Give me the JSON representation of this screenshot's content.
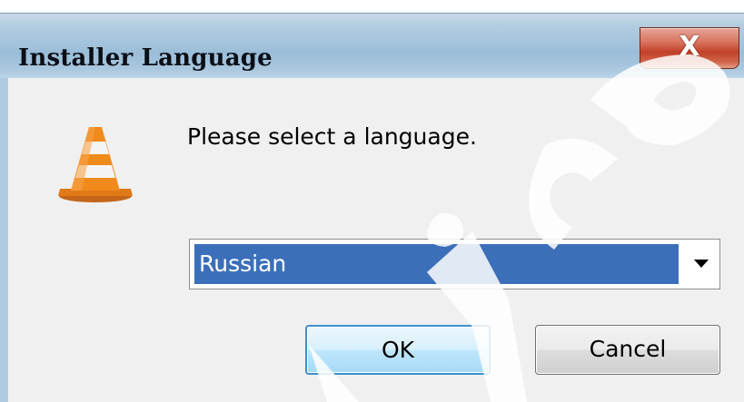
{
  "window": {
    "title": "Installer Language",
    "close_label": "X"
  },
  "dialog": {
    "message": "Please select a language.",
    "icon": "vlc-cone-icon"
  },
  "language_select": {
    "value": "Russian"
  },
  "buttons": {
    "ok_label": "OK",
    "cancel_label": "Cancel"
  },
  "watermark": {
    "text": "vice"
  },
  "colors": {
    "selection": "#3b6fba",
    "title_bar": "#a4c3db",
    "close_button": "#c2412a",
    "ok_border": "#3c8fcf",
    "cone_orange": "#f08a1c"
  }
}
